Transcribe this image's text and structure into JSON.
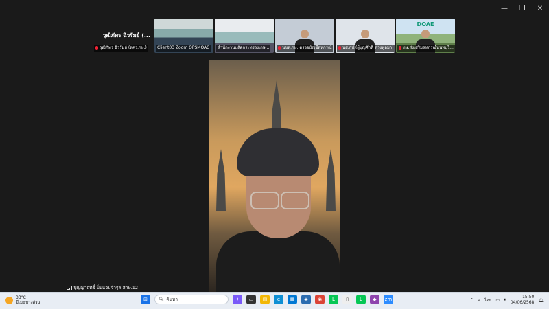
{
  "window_controls": {
    "minimize": "—",
    "maximize": "❐",
    "close": "✕"
  },
  "gallery": {
    "highlight_name": "วุฒิภัทร ฉิวรัมย์ (...",
    "tiles": [
      {
        "label": "วุฒิภัทร ฉิวรัมย์ (สคร.กษ.)"
      },
      {
        "label": "Client03 Zoom OPSMOAC"
      },
      {
        "label": "สำนักงานปลัดกระทรวงเกษ..."
      },
      {
        "label": "นขต.กษ. ตรวจบัญชีสหกรณ์"
      },
      {
        "label": "นส.กป.(ผู้บุญศักดิ์ ดวงทูลมา)"
      },
      {
        "label": "กษ.ส่งเสริมสหกรณ์นนทบุรี..."
      }
    ],
    "tile5_logo": "DOAE"
  },
  "main_video": {
    "participant_name": "บุญญาฤทธิ์ ปิ่นแจ่มจำรุล สกษ.12"
  },
  "taskbar": {
    "weather": {
      "temp": "33°C",
      "desc": "มีเมฆบางส่วน"
    },
    "search_placeholder": "ค้นหา",
    "tray": {
      "lang": "ไทย",
      "time": "15:50",
      "date": "04/06/2568"
    }
  },
  "colors": {
    "background": "#1a1a1a",
    "taskbar": "#e8edf4",
    "mic_muted": "#e22233"
  }
}
